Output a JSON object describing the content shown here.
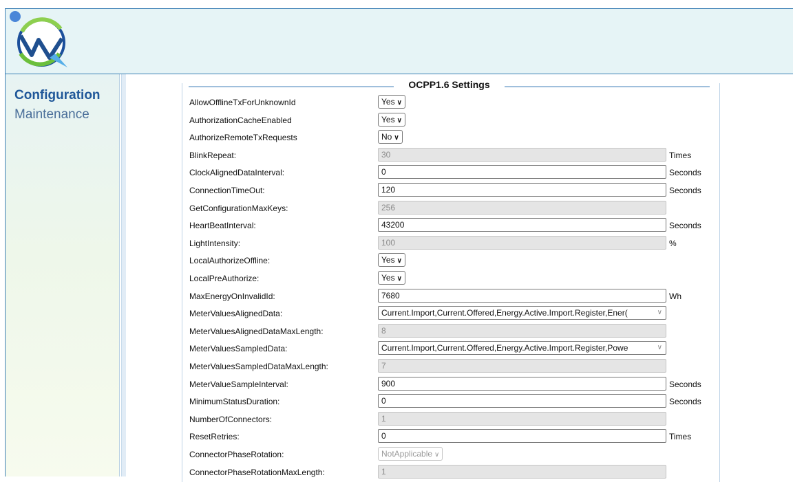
{
  "sidebar": {
    "items": [
      {
        "label": "Configuration"
      },
      {
        "label": "Maintenance"
      }
    ]
  },
  "section": {
    "title": "OCPP1.6 Settings"
  },
  "settings": [
    {
      "label": "AllowOfflineTxForUnknownId",
      "type": "select",
      "value": "Yes",
      "unit": ""
    },
    {
      "label": "AuthorizationCacheEnabled",
      "type": "select",
      "value": "Yes",
      "unit": ""
    },
    {
      "label": "AuthorizeRemoteTxRequests",
      "type": "select",
      "value": "No",
      "unit": ""
    },
    {
      "label": "BlinkRepeat:",
      "type": "readonly",
      "value": "30",
      "unit": "Times"
    },
    {
      "label": "ClockAlignedDataInterval:",
      "type": "text",
      "value": "0",
      "unit": "Seconds"
    },
    {
      "label": "ConnectionTimeOut:",
      "type": "text",
      "value": "120",
      "unit": "Seconds"
    },
    {
      "label": "GetConfigurationMaxKeys:",
      "type": "readonly",
      "value": "256",
      "unit": ""
    },
    {
      "label": "HeartBeatInterval:",
      "type": "text",
      "value": "43200",
      "unit": "Seconds"
    },
    {
      "label": "LightIntensity:",
      "type": "readonly",
      "value": "100",
      "unit": "%"
    },
    {
      "label": "LocalAuthorizeOffline:",
      "type": "select",
      "value": "Yes",
      "unit": ""
    },
    {
      "label": "LocalPreAuthorize:",
      "type": "select",
      "value": "Yes",
      "unit": ""
    },
    {
      "label": "MaxEnergyOnInvalidId:",
      "type": "text",
      "value": "7680",
      "unit": "Wh"
    },
    {
      "label": "MeterValuesAlignedData:",
      "type": "multiselect",
      "value": "Current.Import,Current.Offered,Energy.Active.Import.Register,Ener(",
      "unit": ""
    },
    {
      "label": "MeterValuesAlignedDataMaxLength:",
      "type": "readonly",
      "value": "8",
      "unit": ""
    },
    {
      "label": "MeterValuesSampledData:",
      "type": "multiselect",
      "value": "Current.Import,Current.Offered,Energy.Active.Import.Register,Powe",
      "unit": ""
    },
    {
      "label": "MeterValuesSampledDataMaxLength:",
      "type": "readonly",
      "value": "7",
      "unit": ""
    },
    {
      "label": "MeterValueSampleInterval:",
      "type": "text",
      "value": "900",
      "unit": "Seconds"
    },
    {
      "label": "MinimumStatusDuration:",
      "type": "text",
      "value": "0",
      "unit": "Seconds"
    },
    {
      "label": "NumberOfConnectors:",
      "type": "readonly",
      "value": "1",
      "unit": ""
    },
    {
      "label": "ResetRetries:",
      "type": "text",
      "value": "0",
      "unit": "Times"
    },
    {
      "label": "ConnectorPhaseRotation:",
      "type": "select-disabled",
      "value": "NotApplicable",
      "unit": ""
    },
    {
      "label": "ConnectorPhaseRotationMaxLength:",
      "type": "readonly",
      "value": "1",
      "unit": ""
    }
  ]
}
